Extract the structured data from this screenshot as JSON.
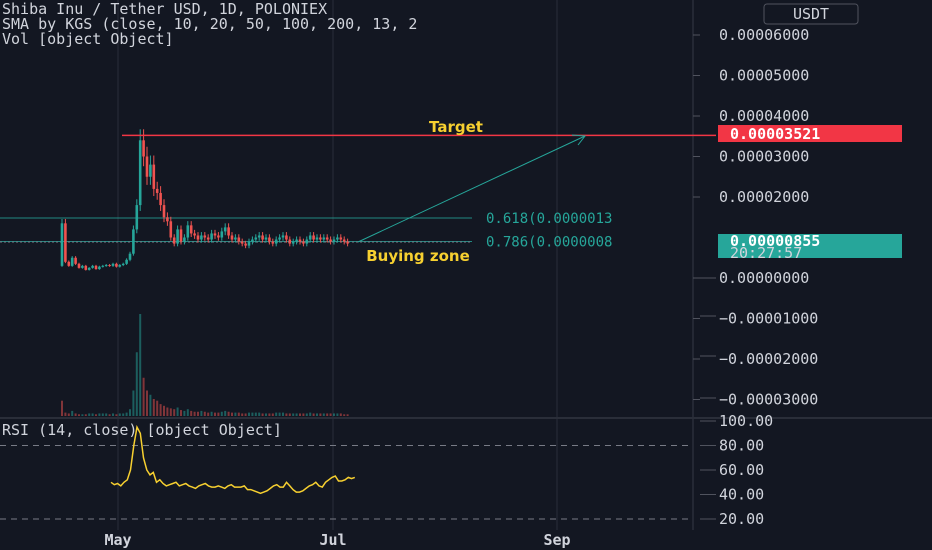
{
  "legend": {
    "title": "Shiba Inu / Tether USD, 1D, POLONIEX",
    "sma": "SMA by KGS (close, 10, 20, 50, 100, 200, 13, 2",
    "vol": "Vol [object Object]"
  },
  "currency_button": "USDT",
  "rsi_legend": "RSI (14, close) [object Object]",
  "price_badges": {
    "target_value": "0.00003521",
    "current_value": "0.00000855",
    "countdown": "20:27:57"
  },
  "colors": {
    "background": "#131722",
    "grid": "#2a2e39",
    "up": "#26a69a",
    "down": "#ef5350",
    "target_line": "#f23645",
    "fib": "#26a69a",
    "rsi": "#f7d030",
    "text": "#d1d4dc"
  },
  "chart_data": [
    {
      "type": "candlestick",
      "title": "Shiba Inu / Tether USD, 1D, POLONIEX",
      "y_ticks": [
        "0.00006000",
        "0.00005000",
        "0.00004000",
        "0.00003000",
        "0.00002000",
        "0.00000000",
        "−0.00001000",
        "−0.00002000",
        "−0.00003000"
      ],
      "x_ticks": [
        "May",
        "Jul",
        "Sep"
      ],
      "ylim": [
        -3.2e-05,
        6.5e-05
      ],
      "grid": true,
      "candles_close": [
        1.35e-05,
        4e-06,
        3e-06,
        5e-06,
        3.5e-06,
        2.5e-06,
        3e-06,
        2e-06,
        2.5e-06,
        3e-06,
        2.2e-06,
        2.8e-06,
        3e-06,
        3.2e-06,
        3e-06,
        3.5e-06,
        2.8e-06,
        3.2e-06,
        3.5e-06,
        4.5e-06,
        6e-06,
        1.2e-05,
        1.8e-05,
        3.4e-05,
        3e-05,
        2.5e-05,
        2.8e-05,
        2.2e-05,
        2.1e-05,
        1.8e-05,
        1.5e-05,
        1.4e-05,
        1e-05,
        8.5e-06,
        1.2e-05,
        9e-06,
        1e-05,
        1.3e-05,
        1.1e-05,
        1.05e-05,
        9.5e-06,
        1.05e-05,
        1e-05,
        9.5e-06,
        1.1e-05,
        1.05e-05,
        1e-05,
        1.15e-05,
        1.25e-05,
        1.05e-05,
        9.5e-06,
        1e-05,
        9e-06,
        8.5e-06,
        8e-06,
        9e-06,
        9.5e-06,
        1e-05,
        1.05e-05,
        9.5e-06,
        1e-05,
        9e-06,
        8.5e-06,
        9.5e-06,
        1e-05,
        1.05e-05,
        9.5e-06,
        8.5e-06,
        9e-06,
        9.5e-06,
        9e-06,
        8.5e-06,
        9.5e-06,
        1.05e-05,
        9.5e-06,
        1e-05,
        9.5e-06,
        1e-05,
        9.5e-06,
        9e-06,
        9.5e-06,
        1e-05,
        9.5e-06,
        9e-06,
        8.5e-06
      ],
      "target": 3.521e-05,
      "current": 8.55e-06,
      "fib_levels": [
        {
          "label": "0.618(0.0000013",
          "value": 1.48e-05
        },
        {
          "label": "0.786(0.0000008",
          "value": 9e-06
        }
      ],
      "annotations": [
        "Target",
        "Buying zone"
      ],
      "volume": [
        18,
        4,
        3,
        6,
        3,
        2,
        2,
        2,
        3,
        3,
        2,
        3,
        3,
        3,
        2,
        3,
        2,
        3,
        3,
        4,
        8,
        30,
        75,
        120,
        45,
        30,
        25,
        20,
        18,
        14,
        12,
        10,
        9,
        8,
        10,
        7,
        6,
        8,
        6,
        5,
        5,
        6,
        5,
        4,
        5,
        4,
        4,
        5,
        6,
        5,
        4,
        4,
        4,
        3,
        3,
        4,
        4,
        4,
        4,
        3,
        3,
        3,
        3,
        4,
        4,
        4,
        3,
        3,
        3,
        3,
        3,
        3,
        3,
        4,
        3,
        3,
        3,
        3,
        3,
        3,
        3,
        3,
        3,
        2,
        2
      ]
    },
    {
      "type": "line",
      "title": "RSI (14, close) [object Object]",
      "y_ticks": [
        "100.00",
        "80.00",
        "60.00",
        "40.00",
        "20.00"
      ],
      "ylim": [
        12,
        100
      ],
      "bands": [
        80,
        20
      ],
      "values": [
        50,
        48,
        49,
        47,
        50,
        52,
        60,
        80,
        95,
        90,
        70,
        60,
        56,
        58,
        50,
        52,
        49,
        47,
        48,
        49,
        50,
        47,
        48,
        49,
        47,
        46,
        45,
        47,
        48,
        49,
        47,
        46,
        46,
        47,
        46,
        45,
        47,
        48,
        46,
        46,
        46,
        47,
        44,
        44,
        43,
        42,
        41,
        42,
        43,
        45,
        47,
        48,
        46,
        46,
        50,
        47,
        44,
        42,
        42,
        43,
        45,
        47,
        48,
        50,
        47,
        46,
        50,
        52,
        54,
        55,
        51,
        51,
        52,
        54,
        53,
        54
      ]
    }
  ]
}
